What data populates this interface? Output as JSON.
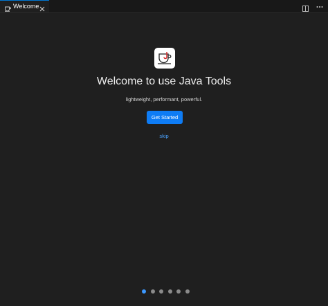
{
  "tab": {
    "label": "Welcome",
    "icon": "coffee-cup-icon",
    "close_icon": "close-icon"
  },
  "toolbar": {
    "split_icon": "split-editor-icon",
    "more_icon": "more-actions-icon"
  },
  "welcome": {
    "logo_icon": "java-tools-logo-icon",
    "title": "Welcome to use Java Tools",
    "subtitle": "lightweight, performant, powerful.",
    "button_label": "Get Started",
    "skip_label": "skip"
  },
  "pagination": {
    "total": 6,
    "current": 1
  },
  "colors": {
    "background": "#1f1f1f",
    "accent": "#0e7cf5",
    "link": "#4aa3ff",
    "dot_active": "#3c98ff",
    "dot_inactive": "#8a8a8a"
  }
}
